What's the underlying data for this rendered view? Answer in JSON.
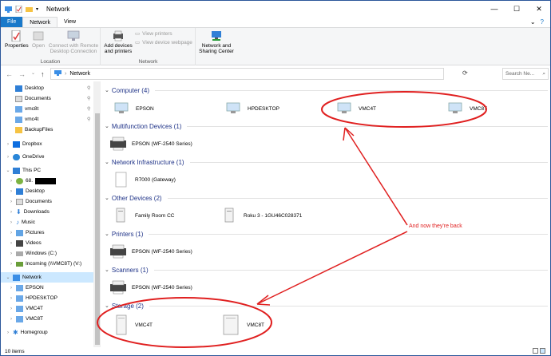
{
  "window": {
    "title": "Network",
    "minimize": "—",
    "maximize": "☐",
    "close": "✕"
  },
  "tabs": [
    {
      "label": "File"
    },
    {
      "label": "Network"
    },
    {
      "label": "View"
    }
  ],
  "ribbon": {
    "properties": "Properties",
    "open": "Open",
    "connect_remote": "Connect with Remote Desktop Connection",
    "group_location": "Location",
    "add_devices": "Add devices and printers",
    "view_printers": "View printers",
    "view_device_webpage": "View device webpage",
    "group_network": "Network",
    "network_sharing": "Network and Sharing Center"
  },
  "address": {
    "path": "Network",
    "search_placeholder": "Search Ne..."
  },
  "nav_pane": {
    "quick": [
      "Desktop",
      "Documents",
      "vmc8t",
      "vmc4t",
      "BackupFiles"
    ],
    "dropbox": "Dropbox",
    "onedrive": "OneDrive",
    "thispc": "This PC",
    "pc_items": [
      "68.",
      "Desktop",
      "Documents",
      "Downloads",
      "Music",
      "Pictures",
      "Videos",
      "Windows (C:)",
      "Incoming (\\\\VMC8T) (V:)"
    ],
    "network": "Network",
    "network_items": [
      "EPSON",
      "HPDESKTOP",
      "VMC4T",
      "VMC8T"
    ],
    "homegroup": "Homegroup"
  },
  "groups": {
    "computer": {
      "header": "Computer (4)",
      "items": [
        "EPSON",
        "HPDESKTOP",
        "VMC4T",
        "VMC8T"
      ]
    },
    "multifunction": {
      "header": "Multifunction Devices (1)",
      "items": [
        "EPSON (WF-2540 Series)"
      ]
    },
    "infrastructure": {
      "header": "Network Infrastructure (1)",
      "items": [
        "R7000 (Gateway)"
      ]
    },
    "other": {
      "header": "Other Devices (2)",
      "items": [
        "Family Room CC",
        "Roku 3 - 1GU46C028371"
      ]
    },
    "printers": {
      "header": "Printers (1)",
      "items": [
        "EPSON (WF-2540 Series)"
      ]
    },
    "scanners": {
      "header": "Scanners (1)",
      "items": [
        "EPSON (WF-2540 Series)"
      ]
    },
    "storage": {
      "header": "Storage (2)",
      "items": [
        "VMC4T",
        "VMC8T"
      ]
    }
  },
  "status": {
    "count": "10 items"
  },
  "annotation": {
    "text": "And now they're back",
    "color": "#e02020"
  }
}
